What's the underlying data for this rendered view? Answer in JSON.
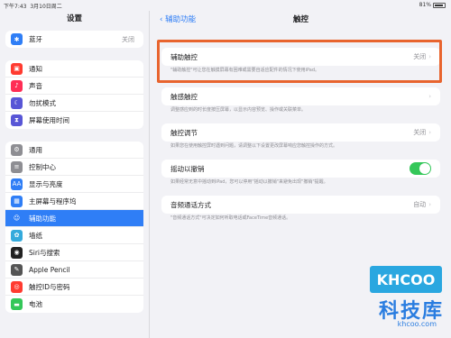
{
  "status": {
    "time": "下午7:43",
    "date": "3月10日周二",
    "battery": "81%"
  },
  "sidebar": {
    "title": "设置",
    "group1": [
      {
        "label": "蓝牙",
        "value": "关闭",
        "icon": "bluetooth-icon",
        "color": "#2f7ef6",
        "glyph": "✱"
      }
    ],
    "group2": [
      {
        "label": "通知",
        "icon": "notifications-icon",
        "color": "#ff3b30",
        "glyph": "▣"
      },
      {
        "label": "声音",
        "icon": "sound-icon",
        "color": "#ff2d55",
        "glyph": "♪"
      },
      {
        "label": "勿扰模式",
        "icon": "moon-icon",
        "color": "#5856d6",
        "glyph": "☾"
      },
      {
        "label": "屏幕使用时间",
        "icon": "hourglass-icon",
        "color": "#5856d6",
        "glyph": "⧗"
      }
    ],
    "group3": [
      {
        "label": "通用",
        "icon": "gear-icon",
        "color": "#8e8e93",
        "glyph": "⚙"
      },
      {
        "label": "控制中心",
        "icon": "control-center-icon",
        "color": "#8e8e93",
        "glyph": "≡"
      },
      {
        "label": "显示与亮度",
        "icon": "display-icon",
        "color": "#2f7ef6",
        "glyph": "AA"
      },
      {
        "label": "主屏幕与程序坞",
        "icon": "home-screen-icon",
        "color": "#2f7ef6",
        "glyph": "▦"
      },
      {
        "label": "辅助功能",
        "icon": "accessibility-icon",
        "color": "#2f7ef6",
        "glyph": "☺",
        "active": true
      },
      {
        "label": "墙纸",
        "icon": "wallpaper-icon",
        "color": "#34aadc",
        "glyph": "✿"
      },
      {
        "label": "Siri与搜索",
        "icon": "siri-icon",
        "color": "#222",
        "glyph": "◉"
      },
      {
        "label": "Apple Pencil",
        "icon": "pencil-icon",
        "color": "#555",
        "glyph": "✎"
      },
      {
        "label": "触控ID与密码",
        "icon": "touch-id-icon",
        "color": "#ff3b30",
        "glyph": "◎"
      },
      {
        "label": "电池",
        "icon": "battery-icon",
        "color": "#34c759",
        "glyph": "▬"
      }
    ]
  },
  "main": {
    "back_label": "辅助功能",
    "title": "触控",
    "assistive_touch": {
      "label": "辅助触控",
      "value": "关闭",
      "desc": "\"辅助触控\"可让您在触摸屏幕有困难或需要自适应配件的情况下使用iPad。"
    },
    "haptic": {
      "label": "触感触控",
      "desc": "调整感应到的时长度按压屏幕，以显示内容预览、操作或关联菜单。"
    },
    "touch_accommodations": {
      "label": "触控调节",
      "value": "关闭",
      "desc": "如果您在使用触控屏时遇到问题，请调整以下设置更改屏幕响应您触控操作的方式。"
    },
    "shake_to_undo": {
      "label": "摇动以撤销",
      "desc": "如果经常无意中摇动到iPad，您可以停用\"摇动以撤销\"来避免出现\"撤销\"提醒。"
    },
    "call_audio": {
      "label": "音频通话方式",
      "value": "自动",
      "desc": "\"音频通话方式\"可决定如何听取电话或FaceTime音频通话。"
    }
  },
  "watermark": {
    "logo": "KHCOO",
    "cn": "科技库",
    "url": "khcoo.com"
  },
  "colors": {
    "accent": "#2f7ef6",
    "highlight": "#e8642e",
    "toggle_on": "#34c759"
  }
}
